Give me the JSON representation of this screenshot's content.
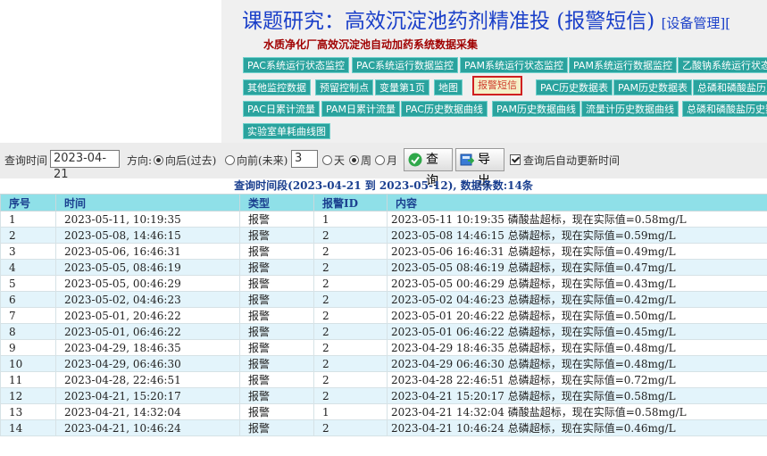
{
  "header": {
    "title": "课题研究：高效沉淀池药剂精准投 (报警短信)",
    "title_suffix": "[设备管理][",
    "subtitle": "水质净化厂高效沉淀池自动加药系统数据采集"
  },
  "nav": {
    "row1": [
      "PAC系统运行状态监控",
      "PAC系统运行数据监控",
      "PAM系统运行状态监控",
      "PAM系统运行数据监控",
      "乙酸钠系统运行状态监"
    ],
    "row2": [
      "其他监控数据",
      "预留控制点",
      "变量第1页",
      "地图",
      "报警短信",
      "PAC历史数据表",
      "PAM历史数据表",
      "总磷和磷酸盐历史"
    ],
    "row3": [
      "PAC日累计流量",
      "PAM日累计流量",
      "PAC历史数据曲线",
      "PAM历史数据曲线",
      "流量计历史数据曲线",
      "总磷和磷酸盐历史数"
    ],
    "row4": [
      "实验室单耗曲线图"
    ],
    "active": "报警短信"
  },
  "query": {
    "time_label": "查询时间",
    "date_value": "2023-04-21",
    "direction_label": "方向:",
    "dir_back": "向后(过去)",
    "dir_forward": "向前(未来)",
    "count_value": "3",
    "unit_day": "天",
    "unit_week": "周",
    "unit_month": "月",
    "selected_direction": "向后(过去)",
    "selected_unit": "周",
    "search_button": "查询",
    "export_button": "导出",
    "auto_update_label": "查询后自动更新时间",
    "auto_update_checked": true
  },
  "table": {
    "caption": "查询时间段(2023-04-21 到 2023-05-12), 数据条数:14条",
    "headers": [
      "序号",
      "时间",
      "类型",
      "报警ID",
      "内容"
    ],
    "rows": [
      [
        "1",
        "2023-05-11, 10:19:35",
        "报警",
        "1",
        "2023-05-11 10:19:35 磷酸盐超标，现在实际值=0.58mg/L"
      ],
      [
        "2",
        "2023-05-08, 14:46:15",
        "报警",
        "2",
        "2023-05-08 14:46:15 总磷超标，现在实际值=0.59mg/L"
      ],
      [
        "3",
        "2023-05-06, 16:46:31",
        "报警",
        "2",
        "2023-05-06 16:46:31 总磷超标，现在实际值=0.49mg/L"
      ],
      [
        "4",
        "2023-05-05, 08:46:19",
        "报警",
        "2",
        "2023-05-05 08:46:19 总磷超标，现在实际值=0.47mg/L"
      ],
      [
        "5",
        "2023-05-05, 00:46:29",
        "报警",
        "2",
        "2023-05-05 00:46:29 总磷超标，现在实际值=0.43mg/L"
      ],
      [
        "6",
        "2023-05-02, 04:46:23",
        "报警",
        "2",
        "2023-05-02 04:46:23 总磷超标，现在实际值=0.42mg/L"
      ],
      [
        "7",
        "2023-05-01, 20:46:22",
        "报警",
        "2",
        "2023-05-01 20:46:22 总磷超标，现在实际值=0.50mg/L"
      ],
      [
        "8",
        "2023-05-01, 06:46:22",
        "报警",
        "2",
        "2023-05-01 06:46:22 总磷超标，现在实际值=0.45mg/L"
      ],
      [
        "9",
        "2023-04-29, 18:46:35",
        "报警",
        "2",
        "2023-04-29 18:46:35 总磷超标，现在实际值=0.48mg/L"
      ],
      [
        "10",
        "2023-04-29, 06:46:30",
        "报警",
        "2",
        "2023-04-29 06:46:30 总磷超标，现在实际值=0.48mg/L"
      ],
      [
        "11",
        "2023-04-28, 22:46:51",
        "报警",
        "2",
        "2023-04-28 22:46:51 总磷超标，现在实际值=0.72mg/L"
      ],
      [
        "12",
        "2023-04-21, 15:20:17",
        "报警",
        "2",
        "2023-04-21 15:20:17 总磷超标，现在实际值=0.58mg/L"
      ],
      [
        "13",
        "2023-04-21, 14:32:04",
        "报警",
        "1",
        "2023-04-21 14:32:04 磷酸盐超标，现在实际值=0.58mg/L"
      ],
      [
        "14",
        "2023-04-21, 10:46:24",
        "报警",
        "2",
        "2023-04-21 10:46:24 总磷超标，现在实际值=0.46mg/L"
      ]
    ]
  },
  "colors": {
    "nav_button": "#2aa39e",
    "title": "#1a3fc9",
    "header_row": "#8fe0e8",
    "row_alt": "#e3f4fb"
  }
}
